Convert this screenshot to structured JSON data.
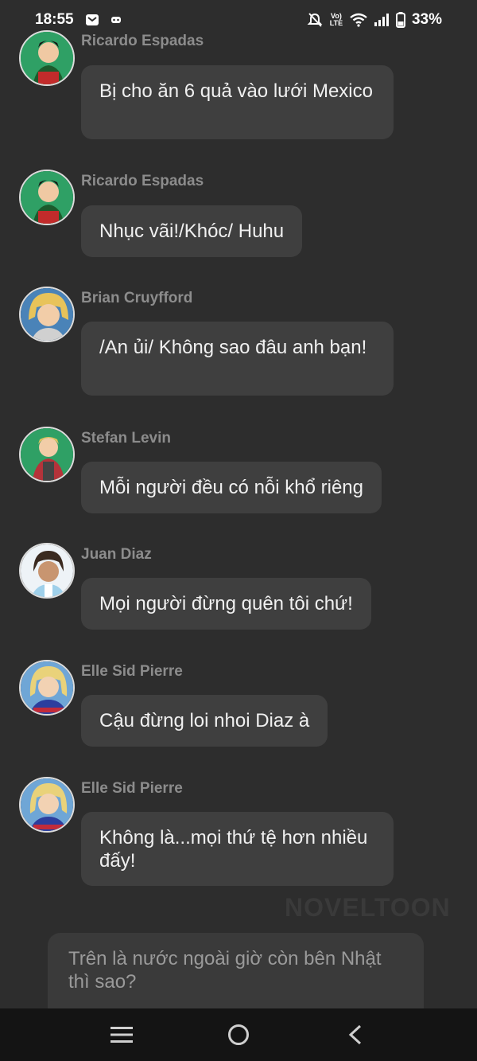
{
  "status": {
    "time": "18:55",
    "battery": "33%",
    "left_icons": [
      "inbox-icon",
      "game-icon"
    ],
    "right_icons": [
      "mute-icon",
      "volte-icon",
      "wifi-icon",
      "signal-icon",
      "battery-icon"
    ],
    "volte_text": "Vo) LTE"
  },
  "messages": [
    {
      "sender": "Ricardo Espadas",
      "text": "Bị cho ăn 6 quả vào lưới Mexico",
      "avatar": "avatar-ricardo"
    },
    {
      "sender": "Ricardo Espadas",
      "text": "Nhục vãi!/Khóc/ Huhu",
      "avatar": "avatar-ricardo"
    },
    {
      "sender": "Brian Cruyfford",
      "text": "/An ủi/ Không sao đâu anh bạn!",
      "avatar": "avatar-brian"
    },
    {
      "sender": "Stefan Levin",
      "text": "Mỗi người đều có nỗi khổ riêng",
      "avatar": "avatar-stefan"
    },
    {
      "sender": "Juan Diaz",
      "text": "Mọi người đừng quên tôi chứ!",
      "avatar": "avatar-juan"
    },
    {
      "sender": "Elle Sid Pierre",
      "text": "Cậu đừng loi nhoi Diaz à",
      "avatar": "avatar-elle"
    },
    {
      "sender": "Elle Sid Pierre",
      "text": "Không là...mọi thứ tệ hơn nhiều đấy!",
      "avatar": "avatar-elle"
    }
  ],
  "watermark": "NOVELTOON",
  "composer_text": "Trên là nước ngoài giờ còn bên Nhật thì sao?",
  "nav": [
    "menu-icon",
    "home-icon",
    "back-icon"
  ]
}
